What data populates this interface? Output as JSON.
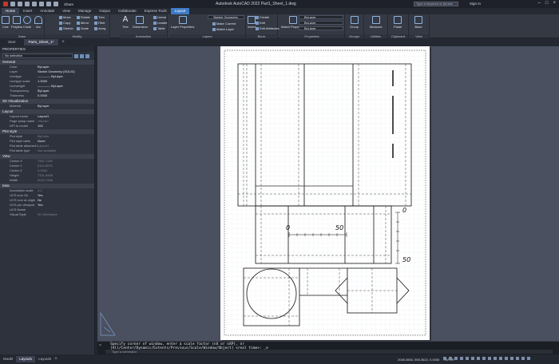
{
  "titlebar": {
    "title": "Autodesk AutoCAD 2022    Part1_Sheet_1.dwg",
    "search_placeholder": "Type a keyword or phrase",
    "sign_in": "Sign In",
    "share": "Share"
  },
  "ribbon_tabs": [
    "Home",
    "Insert",
    "Annotate",
    "View",
    "Manage",
    "Output",
    "Collaborate",
    "Express Tools",
    "Layout"
  ],
  "ribbon": {
    "draw": {
      "label": "Draw",
      "line": "Line",
      "polyline": "Polyline",
      "circle": "Circle",
      "arc": "Arc"
    },
    "modify": {
      "label": "Modify",
      "move": "Move",
      "copy": "Copy",
      "stretch": "Stretch",
      "rotate": "Rotate",
      "mirror": "Mirror",
      "scale": "Scale",
      "trim": "Trim",
      "fillet": "Fillet",
      "array": "Array"
    },
    "annotation": {
      "label": "Annotation",
      "text": "Text",
      "dimension": "Dimension",
      "linear": "Linear",
      "leader": "Leader",
      "table": "Table"
    },
    "layers": {
      "label": "Layers",
      "layer_properties": "Layer Properties",
      "layer_value": "Sketch Geometry",
      "make_current": "Make Current",
      "match_layer": "Match Layer"
    },
    "block": {
      "label": "Block",
      "insert": "Insert",
      "create": "Create",
      "edit": "Edit",
      "edit_attributes": "Edit Attributes"
    },
    "properties": {
      "label": "Properties",
      "match_properties": "Match Properties",
      "color": "ByLayer",
      "linetype": "ByLayer",
      "lineweight": "ByLayer"
    },
    "groups": {
      "label": "Groups",
      "group": "Group"
    },
    "utilities": {
      "label": "Utilities",
      "measure": "Measure"
    },
    "clipboard": {
      "label": "Clipboard",
      "paste": "Paste"
    },
    "view": {
      "label": "View",
      "base": "Base"
    }
  },
  "doc_tabs": [
    "Start",
    "Part1_Sheet_1*"
  ],
  "properties": {
    "title": "PROPERTIES",
    "selection": "No selection",
    "sections": [
      {
        "name": "General",
        "rows": [
          {
            "k": "Color",
            "v": "ByLayer"
          },
          {
            "k": "Layer",
            "v": "Sketch Geometry (SOLID)"
          },
          {
            "k": "Linetype",
            "v": "———— ByLayer"
          },
          {
            "k": "Linetype scale",
            "v": "1.0000"
          },
          {
            "k": "Lineweight",
            "v": "———— ByLayer"
          },
          {
            "k": "Transparency",
            "v": "ByLayer"
          },
          {
            "k": "Thickness",
            "v": "0.0000"
          }
        ]
      },
      {
        "name": "3D Visualization",
        "rows": [
          {
            "k": "Material",
            "v": "ByLayer"
          }
        ]
      },
      {
        "name": "Layout",
        "rows": [
          {
            "k": "Layout name",
            "v": "Layout1"
          },
          {
            "k": "Page setup name",
            "v": "<None>",
            "dim": true
          },
          {
            "k": "DPI to model",
            "v": "100"
          }
        ]
      },
      {
        "name": "Plot style",
        "rows": [
          {
            "k": "Plot style",
            "v": "ByColor",
            "dim": true
          },
          {
            "k": "Plot style table",
            "v": "None"
          },
          {
            "k": "Plot table attached to",
            "v": "Layout1",
            "dim": true
          },
          {
            "k": "Plot table type",
            "v": "Not available",
            "dim": true
          }
        ]
      },
      {
        "name": "View",
        "rows": [
          {
            "k": "Center X",
            "v": "7967.7282",
            "dim": true
          },
          {
            "k": "Center Y",
            "v": "5114.6976",
            "dim": true
          },
          {
            "k": "Center Z",
            "v": "0.0000",
            "dim": true
          },
          {
            "k": "Height",
            "v": "7321.8498",
            "dim": true
          },
          {
            "k": "Width",
            "v": "9020.7496",
            "dim": true
          }
        ]
      },
      {
        "name": "Misc",
        "rows": [
          {
            "k": "Annotation scale",
            "v": "1:1",
            "dim": true
          },
          {
            "k": "UCS icon On",
            "v": "Yes"
          },
          {
            "k": "UCS icon at origin",
            "v": "No"
          },
          {
            "k": "UCS per viewport",
            "v": "Yes"
          },
          {
            "k": "UCS Name",
            "v": ""
          },
          {
            "k": "Visual Style",
            "v": "2D Wireframe",
            "dim": true
          }
        ]
      }
    ]
  },
  "drawing": {
    "scale_label_zero_top": "0",
    "scale_label_fifty_top": "50",
    "scale_label_zero_right": "0",
    "scale_label_fifty_right": "50"
  },
  "command": {
    "history_1": "Specify corner of window, enter a scale factor (nX or nXP), or",
    "history_2": "[All/Center/Dynamic/Extents/Previous/Scale/Window/Object] <real time>:  _e",
    "placeholder": "Type a command"
  },
  "status": {
    "tabs": [
      "Model",
      "Layout1",
      "Layout2"
    ],
    "coords": "2046.3563, 555.3622, 0.0000",
    "paper": "PAPER"
  }
}
